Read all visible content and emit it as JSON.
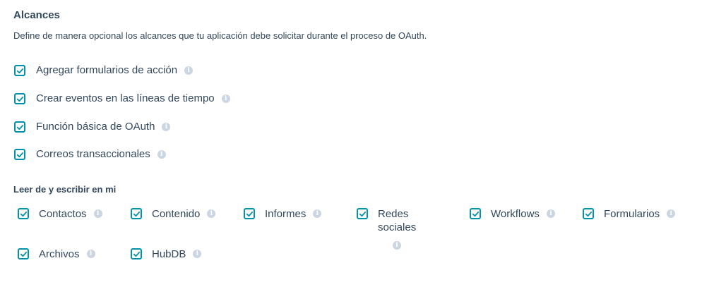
{
  "section": {
    "title": "Alcances",
    "description": "Define de manera opcional los alcances que tu aplicación debe solicitar durante el proceso de OAuth."
  },
  "scopes": [
    {
      "label": "Agregar formularios de acción",
      "checked": true
    },
    {
      "label": "Crear eventos en las líneas de tiempo",
      "checked": true
    },
    {
      "label": "Función básica de OAuth",
      "checked": true
    },
    {
      "label": "Correos transaccionales",
      "checked": true
    }
  ],
  "read_write": {
    "title": "Leer de y escribir en mi",
    "items": [
      {
        "label": "Contactos",
        "checked": true
      },
      {
        "label": "Contenido",
        "checked": true
      },
      {
        "label": "Informes",
        "checked": true
      },
      {
        "label": "Redes sociales",
        "checked": true
      },
      {
        "label": "Workflows",
        "checked": true
      },
      {
        "label": "Formularios",
        "checked": true
      },
      {
        "label": "Archivos",
        "checked": true
      },
      {
        "label": "HubDB",
        "checked": true
      }
    ]
  },
  "icons": {
    "checkbox_checked": "checkmark-icon",
    "info": "info-icon"
  },
  "colors": {
    "accent": "#0091ae",
    "text": "#33475b",
    "info_icon": "#cbd6e2"
  }
}
